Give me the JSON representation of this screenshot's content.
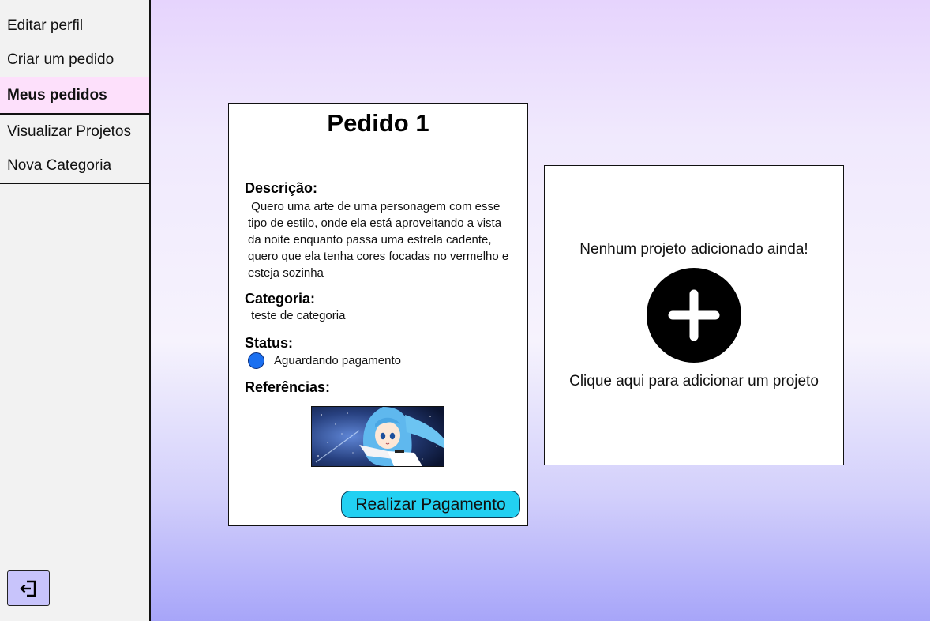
{
  "sidebar": {
    "items": [
      {
        "label": "Editar perfil"
      },
      {
        "label": "Criar um pedido"
      },
      {
        "label": "Meus pedidos",
        "active": true
      },
      {
        "label": "Visualizar Projetos"
      },
      {
        "label": "Nova Categoria"
      }
    ],
    "logout_icon": "logout-icon"
  },
  "order": {
    "title": "Pedido 1",
    "description_label": "Descrição:",
    "description": "Quero uma arte de uma personagem com esse tipo de estilo, onde ela está aproveitando a vista da noite enquanto passa uma estrela cadente, quero que ela tenha cores focadas no vermelho e esteja sozinha",
    "category_label": "Categoria:",
    "category": "teste de categoria",
    "status_label": "Status:",
    "status": "Aguardando pagamento",
    "status_color": "#1a6ff0",
    "references_label": "Referências:",
    "pay_button": "Realizar Pagamento",
    "pay_button_color": "#22d0f2"
  },
  "projects": {
    "empty_message": "Nenhum projeto adicionado ainda!",
    "add_icon": "plus-icon",
    "add_hint": "Clique aqui para adicionar um projeto"
  }
}
